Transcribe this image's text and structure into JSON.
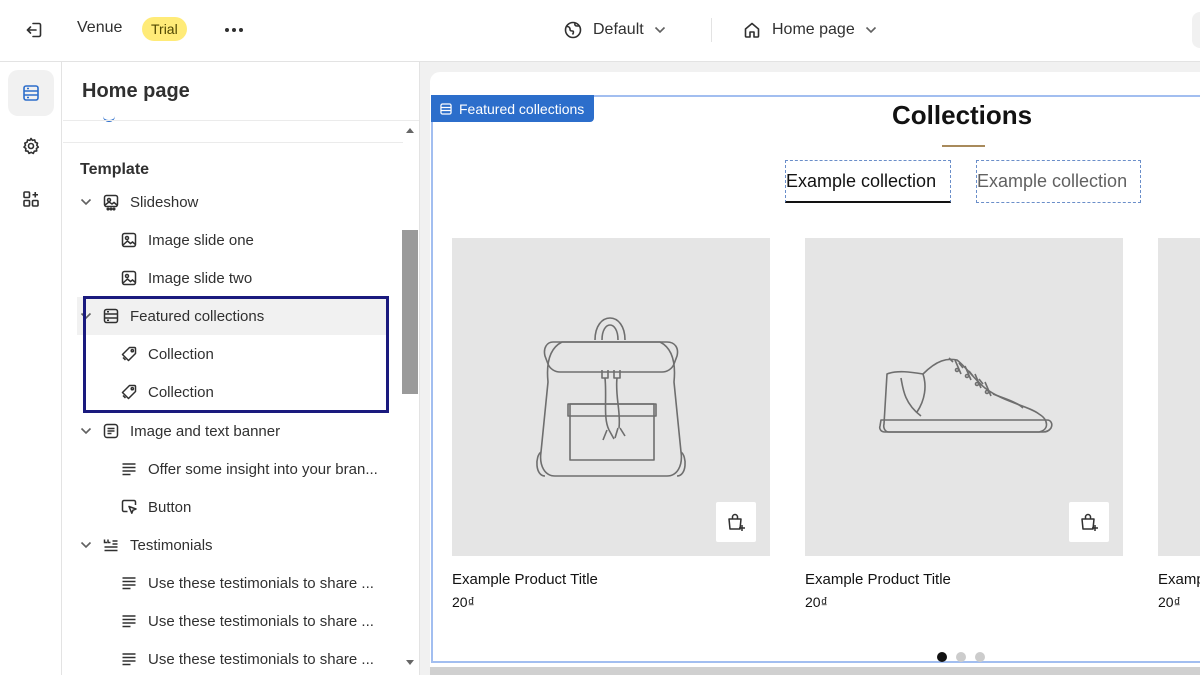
{
  "topbar": {
    "store_name": "Venue",
    "trial_badge": "Trial",
    "theme_label": "Default",
    "page_label": "Home page"
  },
  "panel": {
    "title": "Home page",
    "section_heading": "Template",
    "tree": [
      {
        "label": "Slideshow",
        "level": 1,
        "icon": "slideshow-icon"
      },
      {
        "label": "Image slide one",
        "level": 2,
        "icon": "image-icon"
      },
      {
        "label": "Image slide two",
        "level": 2,
        "icon": "image-icon"
      },
      {
        "label": "Featured collections",
        "level": 1,
        "icon": "collections-icon"
      },
      {
        "label": "Collection",
        "level": 2,
        "icon": "tag-icon"
      },
      {
        "label": "Collection",
        "level": 2,
        "icon": "tag-icon"
      },
      {
        "label": "Image and text banner",
        "level": 1,
        "icon": "banner-icon"
      },
      {
        "label": "Offer some insight into your bran...",
        "level": 2,
        "icon": "text-icon"
      },
      {
        "label": "Button",
        "level": 2,
        "icon": "pointer-icon"
      },
      {
        "label": "Testimonials",
        "level": 1,
        "icon": "quote-icon"
      },
      {
        "label": "Use these testimonials to share ...",
        "level": 2,
        "icon": "text-icon"
      },
      {
        "label": "Use these testimonials to share ...",
        "level": 2,
        "icon": "text-icon"
      },
      {
        "label": "Use these testimonials to share ...",
        "level": 2,
        "icon": "text-icon"
      }
    ]
  },
  "preview": {
    "section_tag": "Featured collections",
    "title": "Collections",
    "tabs": [
      "Example collection",
      "Example collection"
    ],
    "products": [
      {
        "title": "Example Product Title",
        "price": "20₫",
        "image": "backpack-illustration"
      },
      {
        "title": "Example Product Title",
        "price": "20₫",
        "image": "sneaker-illustration"
      },
      {
        "title": "Example Product Title",
        "price": "20₫",
        "image": "product-illustration"
      }
    ],
    "slide_count": 3,
    "active_slide": 1
  },
  "colors": {
    "accent": "#2c6ecb",
    "highlight_outline": "#1a1a7e",
    "trial_badge": "#ffeb78",
    "title_underline": "#a88a5b"
  }
}
